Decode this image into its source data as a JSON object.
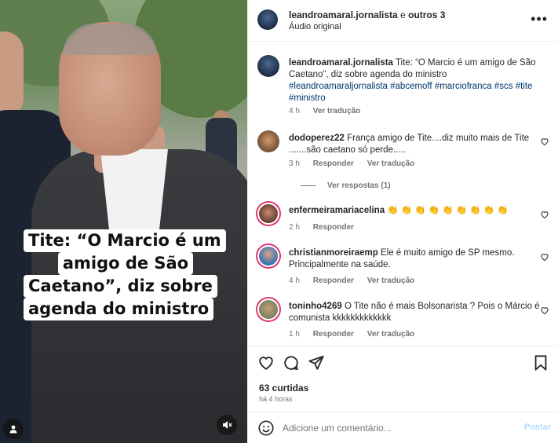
{
  "video": {
    "overlay_lines": [
      "Tite: “O Marcio é um",
      "amigo de São",
      "Caetano”, diz sobre",
      "agenda do ministro"
    ],
    "user_icon": "person-icon",
    "mute_icon": "speaker-muted-icon"
  },
  "header": {
    "username": "leandroamaral.jornalista",
    "joiner": "e",
    "others": "outros 3",
    "audio": "Áudio original",
    "more_icon": "more-horizontal-icon"
  },
  "caption": {
    "username": "leandroamaral.jornalista",
    "text": "Tite: “O Marcio é um amigo de São Caetano”, diz sobre agenda do ministro",
    "hashtags": "#leandroamaraljornalista #abcemoff #marciofranca #scs #tite #ministro",
    "time": "4 h",
    "translate": "Ver tradução"
  },
  "comments": [
    {
      "username": "dodoperez22",
      "text": "França amigo de Tite....diz muito mais de Tite .......são caetano só perde.....",
      "time": "3 h",
      "reply": "Responder",
      "translate": "Ver tradução",
      "view_replies": "Ver respostas (1)"
    },
    {
      "username": "enfermeiramariacelina",
      "text": "👏 👏 👏 👏 👏 👏 👏 👏 👏",
      "time": "2 h",
      "reply": "Responder"
    },
    {
      "username": "christianmoreiraemp",
      "text": "Ele é muito amigo de SP mesmo. Principalmente na saúde.",
      "time": "4 h",
      "reply": "Responder",
      "translate": "Ver tradução"
    },
    {
      "username": "toninho4269",
      "text": "O Tite não é mais Bolsonarista ? Pois o Márcio é comunista kkkkkkkkkkkkk",
      "time": "1 h",
      "reply": "Responder",
      "translate": "Ver tradução"
    }
  ],
  "actions": {
    "likes": "63 curtidas",
    "posted": "há 4 horas"
  },
  "add_comment": {
    "placeholder": "Adicione um comentário...",
    "post": "Postar"
  },
  "colors": {
    "link": "#00376b",
    "muted": "#737373",
    "post_disabled": "#b3dbff",
    "story_ring": "#e1306c"
  }
}
